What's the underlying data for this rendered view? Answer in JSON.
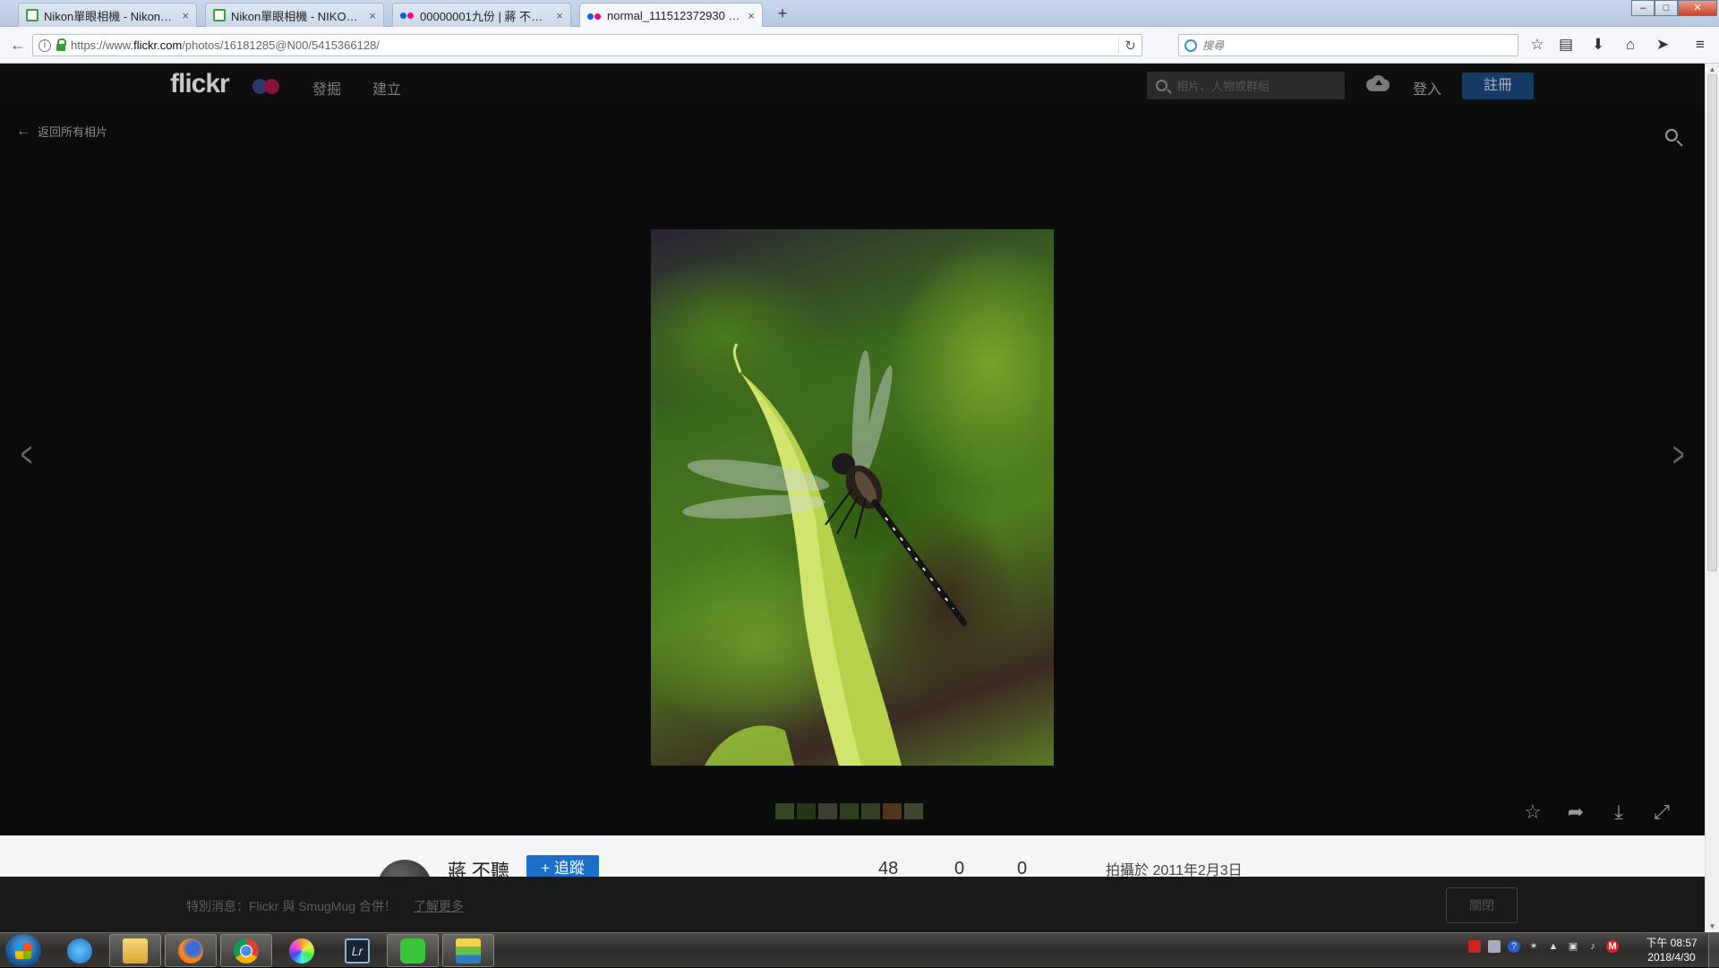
{
  "browser": {
    "tabs": [
      {
        "title": "Nikon單眼相機 - Nikon D...",
        "favicon": "green-window-icon",
        "active": false
      },
      {
        "title": "Nikon單眼相機 - NIKONE...",
        "favicon": "green-window-icon",
        "active": false
      },
      {
        "title": "00000001九份 | 蔣 不聽 | ...",
        "favicon": "flickr-dots-icon",
        "active": false
      },
      {
        "title": "normal_111512372930 | ...",
        "favicon": "flickr-dots-icon",
        "active": true
      }
    ],
    "tab_close": "×",
    "new_tab": "+",
    "url_prefix": "https://www.",
    "url_domain": "flickr.com",
    "url_path": "/photos/16181285@N00/5415366128/",
    "search_placeholder": "搜尋",
    "window_controls": {
      "minimize": "–",
      "maximize": "□",
      "close": "✕"
    }
  },
  "flickr": {
    "logo": "flickr",
    "nav": {
      "explore": "發掘",
      "create": "建立"
    },
    "search_placeholder": "相片、人物或群組",
    "login": "登入",
    "signup": "註冊",
    "back_link": "返回所有相片",
    "filmstrip_colors": [
      "#5a7a3a",
      "#3a5a22",
      "#6a6a4a",
      "#4a6a2a",
      "#556b3a",
      "#8a5a2a",
      "#6a7a4a"
    ]
  },
  "info": {
    "author": "蔣 不聽",
    "follow": "+ 追蹤",
    "stats": [
      "48",
      "0",
      "0"
    ],
    "taken": "拍攝於 2011年2月3日"
  },
  "banner": {
    "text": "特別消息：Flickr 與 SmugMug 合併！",
    "link": "了解更多",
    "close": "關閉"
  },
  "taskbar": {
    "clock_time": "下午 08:57",
    "clock_date": "2018/4/30"
  }
}
